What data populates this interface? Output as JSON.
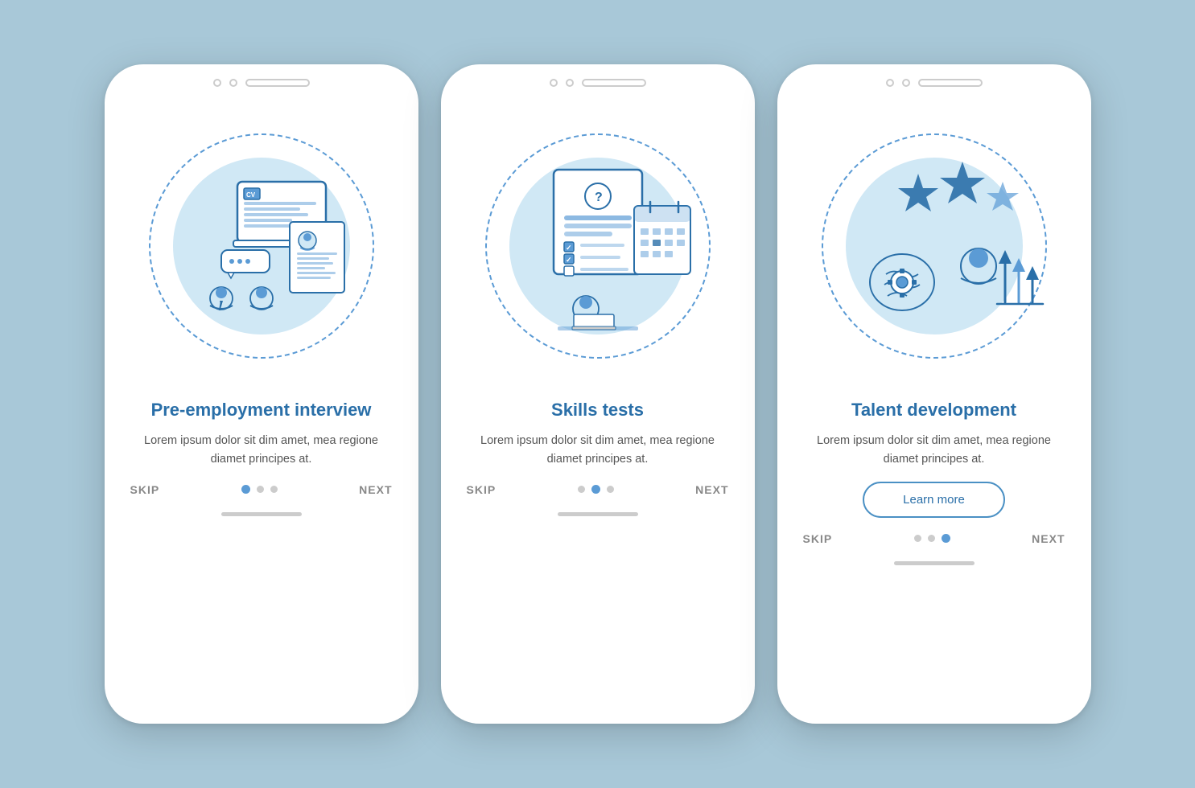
{
  "background_color": "#a8c8d8",
  "phones": [
    {
      "id": "phone-1",
      "title": "Pre-employment interview",
      "description": "Lorem ipsum dolor sit dim amet, mea regione diamet principes at.",
      "skip_label": "SKIP",
      "next_label": "NEXT",
      "active_dot": 0,
      "show_learn_more": false,
      "learn_more_label": ""
    },
    {
      "id": "phone-2",
      "title": "Skills tests",
      "description": "Lorem ipsum dolor sit dim amet, mea regione diamet principes at.",
      "skip_label": "SKIP",
      "next_label": "NEXT",
      "active_dot": 1,
      "show_learn_more": false,
      "learn_more_label": ""
    },
    {
      "id": "phone-3",
      "title": "Talent development",
      "description": "Lorem ipsum dolor sit dim amet, mea regione diamet principes at.",
      "skip_label": "SKIP",
      "next_label": "NEXT",
      "active_dot": 2,
      "show_learn_more": true,
      "learn_more_label": "Learn more"
    }
  ]
}
